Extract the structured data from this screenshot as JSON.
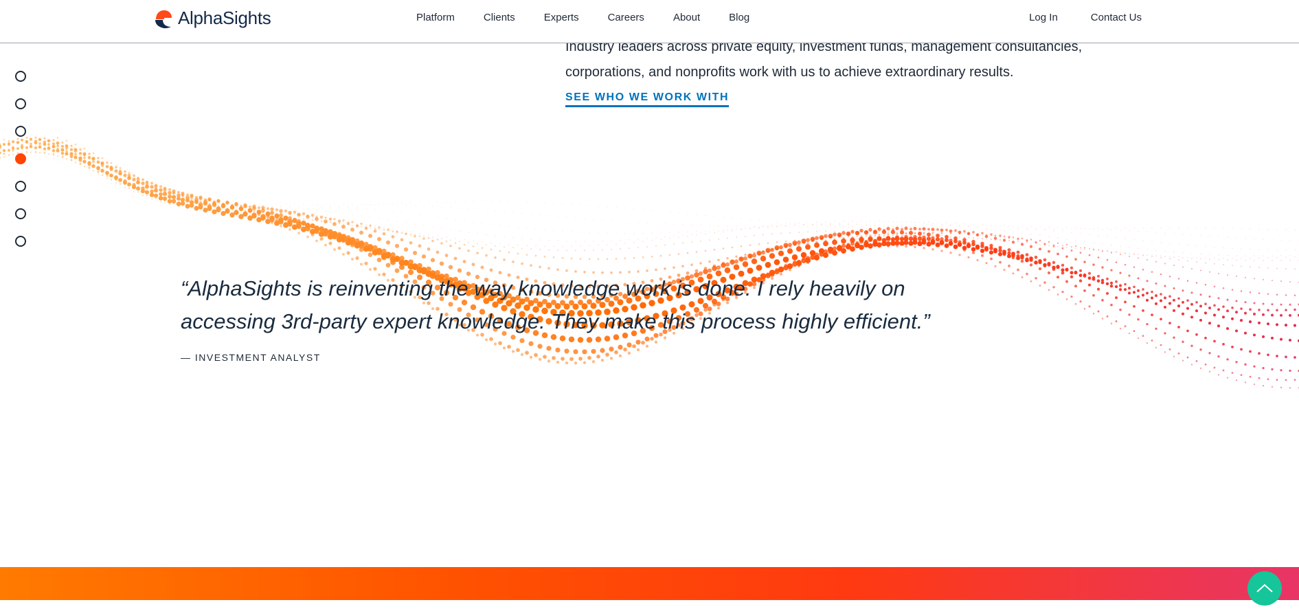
{
  "header": {
    "brand": "AlphaSights",
    "nav": [
      "Platform",
      "Clients",
      "Experts",
      "Careers",
      "About",
      "Blog"
    ],
    "login": "Log In",
    "contact": "Contact Us"
  },
  "intro": {
    "line1": "Industry leaders across private equity, investment funds, management consultancies,",
    "line2": "corporations, and nonprofits work with us to achieve extraordinary results.",
    "link": "SEE WHO WE WORK WITH"
  },
  "pager": {
    "count": 7,
    "active_index": 3
  },
  "testimonial": {
    "quote": "“AlphaSights is reinventing the way knowledge work is done. I rely heavily on accessing 3rd-party expert knowledge. They make this process highly efficient.”",
    "author": "— INVESTMENT ANALYST"
  },
  "colors": {
    "accent": "#ff4500",
    "link": "#0072bc",
    "brand_navy": "#13294b",
    "scroll_button": "#16c59a"
  },
  "icons": {
    "scroll_top": "chevron-up-icon",
    "logo": "alphasights-logo-icon"
  }
}
